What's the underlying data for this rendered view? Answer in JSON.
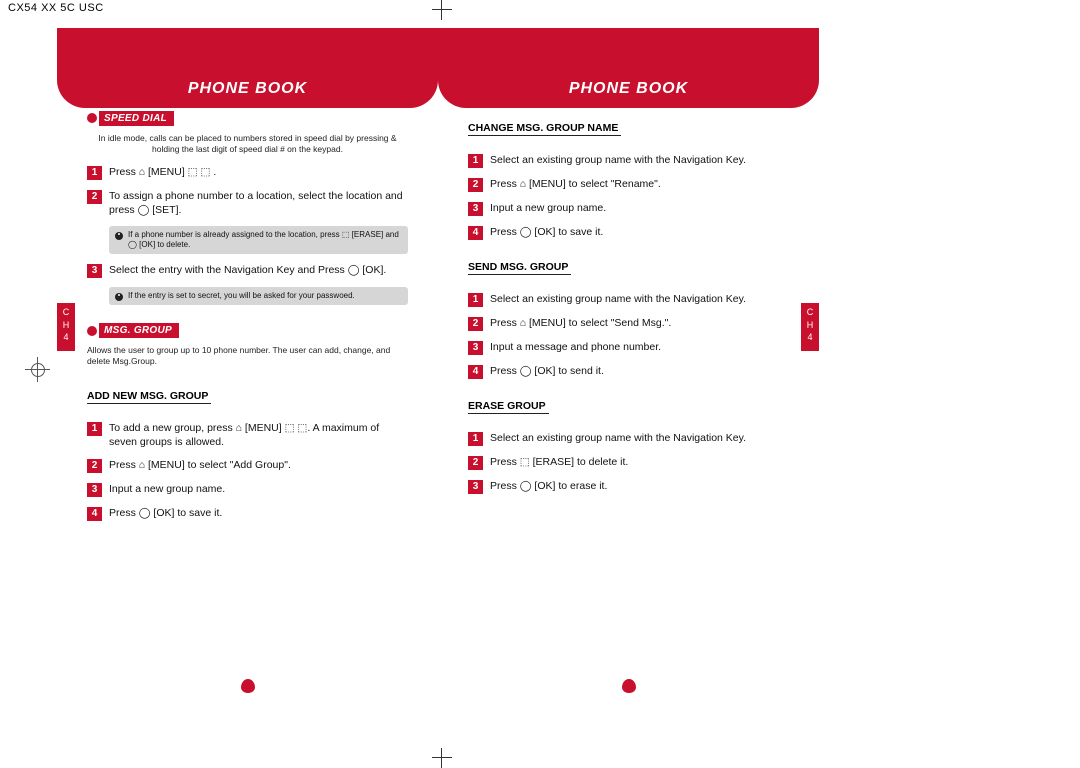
{
  "top_header_text": "CX54  XX  5C USC",
  "chapter_label": "C\nH\n4",
  "page_left": {
    "header": "PHONE BOOK",
    "section1": {
      "title": "SPEED DIAL",
      "intro": "In idle mode, calls can be placed to numbers stored in speed dial by pressing & holding the last digit of speed dial # on the keypad.",
      "steps": [
        "Press  ⌂ [MENU]  ⬚ ⬚ .",
        "To assign a phone number to a location, select the location and press ◯ [SET].",
        "Select the entry with the Navigation Key and Press ◯ [OK]."
      ],
      "note1": "If a phone number is already assigned to the location, press ⬚ [ERASE] and ◯ [OK] to delete.",
      "note2": "If the entry is set to secret, you will be asked for your passwoed."
    },
    "section2": {
      "title": "MSG. GROUP",
      "intro": "Allows the user to group up to 10 phone number. The user can add, change, and delete Msg.Group.",
      "sub1_title": "ADD NEW MSG. GROUP",
      "sub1_steps": [
        "To add a new group, press ⌂ [MENU] ⬚ ⬚. A maximum of seven groups is allowed.",
        "Press ⌂ [MENU] to select \"Add Group\".",
        "Input a new group name.",
        "Press ◯ [OK] to save it."
      ]
    }
  },
  "page_right": {
    "header": "PHONE BOOK",
    "sub1_title": "CHANGE MSG. GROUP NAME",
    "sub1_steps": [
      "Select an existing group name with the Navigation Key.",
      "Press ⌂ [MENU] to select \"Rename\".",
      "Input a new group name.",
      "Press ◯ [OK] to save it."
    ],
    "sub2_title": "SEND MSG. GROUP",
    "sub2_steps": [
      "Select an existing group name with the Navigation Key.",
      "Press ⌂ [MENU] to select \"Send Msg.\".",
      "Input a message and phone number.",
      "Press ◯ [OK] to send it."
    ],
    "sub3_title": "ERASE GROUP",
    "sub3_steps": [
      "Select an existing group name with the Navigation Key.",
      "Press ⬚ [ERASE] to delete it.",
      "Press ◯ [OK] to erase it."
    ]
  }
}
